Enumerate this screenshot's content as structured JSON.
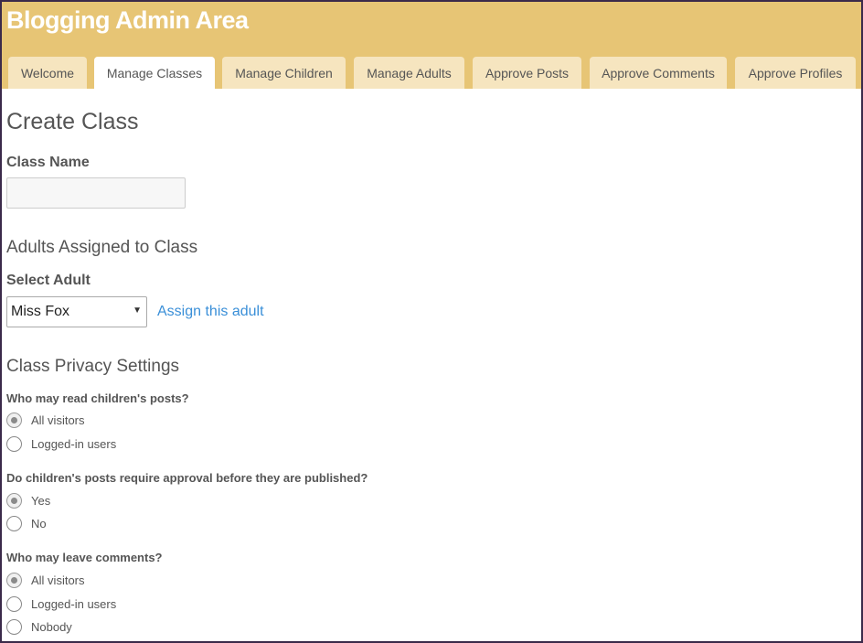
{
  "header": {
    "title": "Blogging Admin Area"
  },
  "tabs": [
    {
      "label": "Welcome",
      "active": false
    },
    {
      "label": "Manage Classes",
      "active": true
    },
    {
      "label": "Manage Children",
      "active": false
    },
    {
      "label": "Manage Adults",
      "active": false
    },
    {
      "label": "Approve Posts",
      "active": false
    },
    {
      "label": "Approve Comments",
      "active": false
    },
    {
      "label": "Approve Profiles",
      "active": false
    }
  ],
  "form": {
    "title": "Create Class",
    "class_name": {
      "label": "Class Name",
      "value": "",
      "placeholder": ""
    },
    "adults_section": "Adults Assigned to Class",
    "select_adult": {
      "label": "Select Adult",
      "selected": "Miss Fox"
    },
    "assign_link": "Assign this adult",
    "privacy_section": "Class Privacy Settings",
    "questions": [
      {
        "label": "Who may read children's posts?",
        "options": [
          {
            "label": "All visitors",
            "checked": true
          },
          {
            "label": "Logged-in users",
            "checked": false
          }
        ]
      },
      {
        "label": "Do children's posts require approval before they are published?",
        "options": [
          {
            "label": "Yes",
            "checked": true
          },
          {
            "label": "No",
            "checked": false
          }
        ]
      },
      {
        "label": "Who may leave comments?",
        "options": [
          {
            "label": "All visitors",
            "checked": true
          },
          {
            "label": "Logged-in users",
            "checked": false
          },
          {
            "label": "Nobody",
            "checked": false
          }
        ]
      }
    ]
  },
  "colors": {
    "header_bg": "#e7c575",
    "tab_bg": "#f6e5bf",
    "link": "#3a8fd8",
    "text": "#555555"
  },
  "icons": {
    "select_arrow": "chevron-down-icon"
  }
}
